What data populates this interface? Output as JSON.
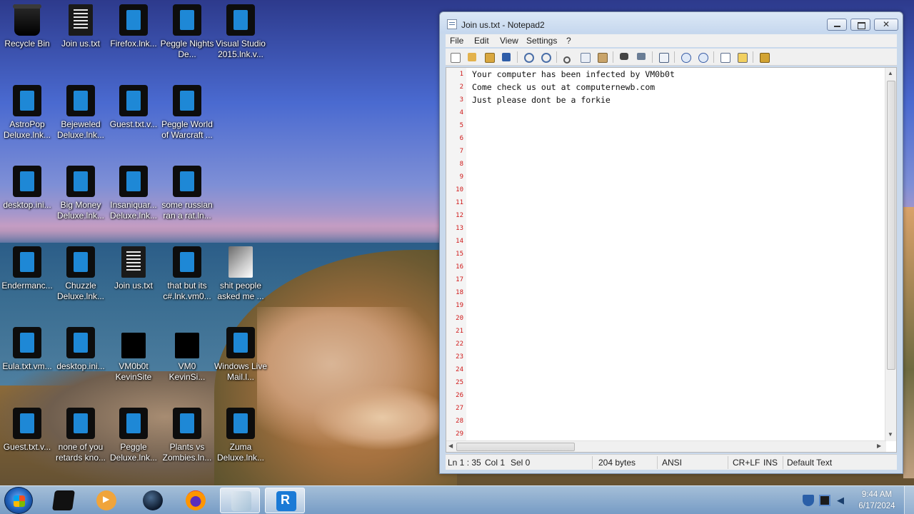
{
  "desktop": {
    "icons": [
      {
        "label": "Recycle Bin",
        "type": "bin"
      },
      {
        "label": "Join us.txt",
        "type": "txt"
      },
      {
        "label": "Firefox.lnk...",
        "type": "lnk"
      },
      {
        "label": "Peggle Nights De...",
        "type": "lnk"
      },
      {
        "label": "Visual Studio 2015.lnk.v...",
        "type": "lnk"
      },
      {
        "label": "AstroPop Deluxe.lnk...",
        "type": "lnk"
      },
      {
        "label": "Bejeweled Deluxe.lnk...",
        "type": "lnk"
      },
      {
        "label": "Guest.txt.v...",
        "type": "lnk"
      },
      {
        "label": "Peggle World of Warcraft ...",
        "type": "lnk"
      },
      {
        "label": "desktop.ini...",
        "type": "lnk"
      },
      {
        "label": "Big Money Deluxe.lnk...",
        "type": "lnk"
      },
      {
        "label": "Insaniquar... Deluxe.lnk...",
        "type": "lnk"
      },
      {
        "label": "some russian ran a rat.ln...",
        "type": "lnk"
      },
      {
        "label": "Endermanc...",
        "type": "lnk"
      },
      {
        "label": "Chuzzle Deluxe.lnk...",
        "type": "lnk"
      },
      {
        "label": "Join us.txt",
        "type": "txt"
      },
      {
        "label": "that but its c#.lnk.vm0...",
        "type": "lnk"
      },
      {
        "label": "shit people asked me ...",
        "type": "folder"
      },
      {
        "label": "Eula.txt.vm...",
        "type": "lnk"
      },
      {
        "label": "desktop.ini...",
        "type": "lnk"
      },
      {
        "label": "VM0b0t KevinSite",
        "type": "blackbox"
      },
      {
        "label": "VM0 KevinSi...",
        "type": "blackbox"
      },
      {
        "label": "Windows Live Mail.l...",
        "type": "lnk"
      },
      {
        "label": "Guest.txt.v...",
        "type": "lnk"
      },
      {
        "label": "none of you retards kno...",
        "type": "lnk"
      },
      {
        "label": "Peggle Deluxe.lnk...",
        "type": "lnk"
      },
      {
        "label": "Plants vs Zombies.ln...",
        "type": "lnk"
      },
      {
        "label": "Zuma Deluxe.lnk...",
        "type": "lnk"
      }
    ]
  },
  "notepad": {
    "title": "Join us.txt - Notepad2",
    "menu": [
      "File",
      "Edit",
      "View",
      "Settings",
      "?"
    ],
    "toolbar": [
      "new-icon",
      "open-icon",
      "browse-icon",
      "save-icon",
      "undo-icon",
      "redo-icon",
      "cut-icon",
      "copy-icon",
      "paste-icon",
      "find-icon",
      "replace-icon",
      "word-wrap-icon",
      "zoom-in-icon",
      "zoom-out-icon",
      "scheme-icon",
      "customize-icon",
      "exit-icon"
    ],
    "lines": [
      "Your computer has been infected by VM0b0t",
      "Come check us out at computernewb.com",
      "Just please dont be a forkie"
    ],
    "line_numbers": [
      "1",
      "2",
      "3",
      "4",
      "5",
      "6",
      "7",
      "8",
      "9",
      "10",
      "11",
      "12",
      "13",
      "14",
      "15",
      "16",
      "17",
      "18",
      "19",
      "20",
      "21",
      "22",
      "23",
      "24",
      "25",
      "26",
      "27",
      "28",
      "29"
    ],
    "status": {
      "position": "Ln 1 : 35",
      "col": "Col 1",
      "sel": "Sel 0",
      "size": "204 bytes",
      "encoding": "ANSI",
      "eol": "CR+LF",
      "mode": "INS",
      "scheme": "Default Text"
    }
  },
  "taskbar": {
    "apps": [
      "cube-app",
      "media-player",
      "sphere-app",
      "firefox",
      "notepad2",
      "rx-app"
    ],
    "clock": {
      "time": "9:44 AM",
      "date": "6/17/2024"
    }
  },
  "colors": {
    "line_number": "#d01818",
    "window_frame": "#c9d9ec"
  }
}
